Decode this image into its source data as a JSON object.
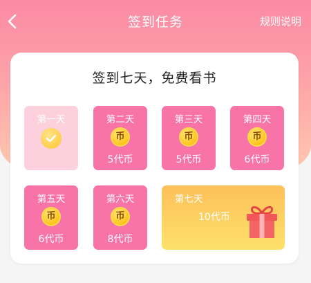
{
  "nav": {
    "title": "签到任务",
    "rules_label": "规则说明"
  },
  "card": {
    "title": "签到七天，免费看书"
  },
  "coin_glyph": "币",
  "days": [
    {
      "label": "第一天",
      "reward": "",
      "signed": true
    },
    {
      "label": "第二天",
      "reward": "5代币",
      "signed": false
    },
    {
      "label": "第三天",
      "reward": "5代币",
      "signed": false
    },
    {
      "label": "第四天",
      "reward": "6代币",
      "signed": false
    },
    {
      "label": "第五天",
      "reward": "6代币",
      "signed": false
    },
    {
      "label": "第六天",
      "reward": "8代币",
      "signed": false
    },
    {
      "label": "第七天",
      "reward": "10代币",
      "signed": false
    }
  ],
  "colors": {
    "day_card": "#f873a8",
    "day_signed": "#fdd0dd",
    "day7_gradient_top": "#fdc05a",
    "day7_gradient_bottom": "#fde16b",
    "header_gradient_top": "#fb8aa4"
  },
  "icons": [
    "back-arrow-icon",
    "check-icon",
    "coin-icon",
    "gift-icon"
  ]
}
